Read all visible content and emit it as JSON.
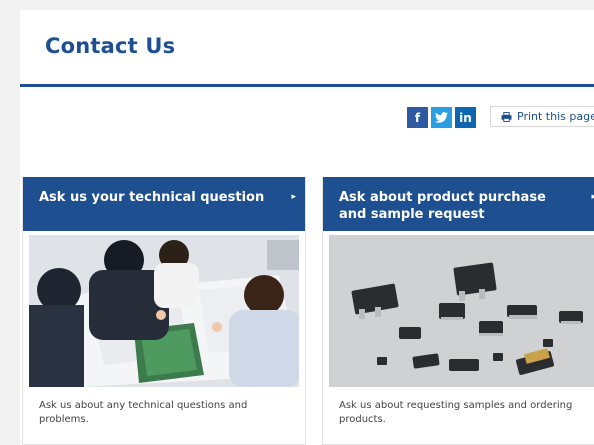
{
  "page": {
    "title": "Contact Us"
  },
  "share": {
    "facebook": "f",
    "twitter": "t",
    "linkedin": "in",
    "print_label": "Print this page"
  },
  "cards": [
    {
      "heading": "Ask us your technical question",
      "image_alt": "",
      "description": "Ask us about any technical questions and problems."
    },
    {
      "heading": "Ask about product purchase and sample request",
      "image_alt": "",
      "description": "Ask us about requesting samples and ordering products."
    }
  ],
  "colors": {
    "brand": "#1d4f91",
    "facebook": "#2d5aa0",
    "twitter": "#2a9ee0",
    "linkedin": "#0f66b0"
  }
}
